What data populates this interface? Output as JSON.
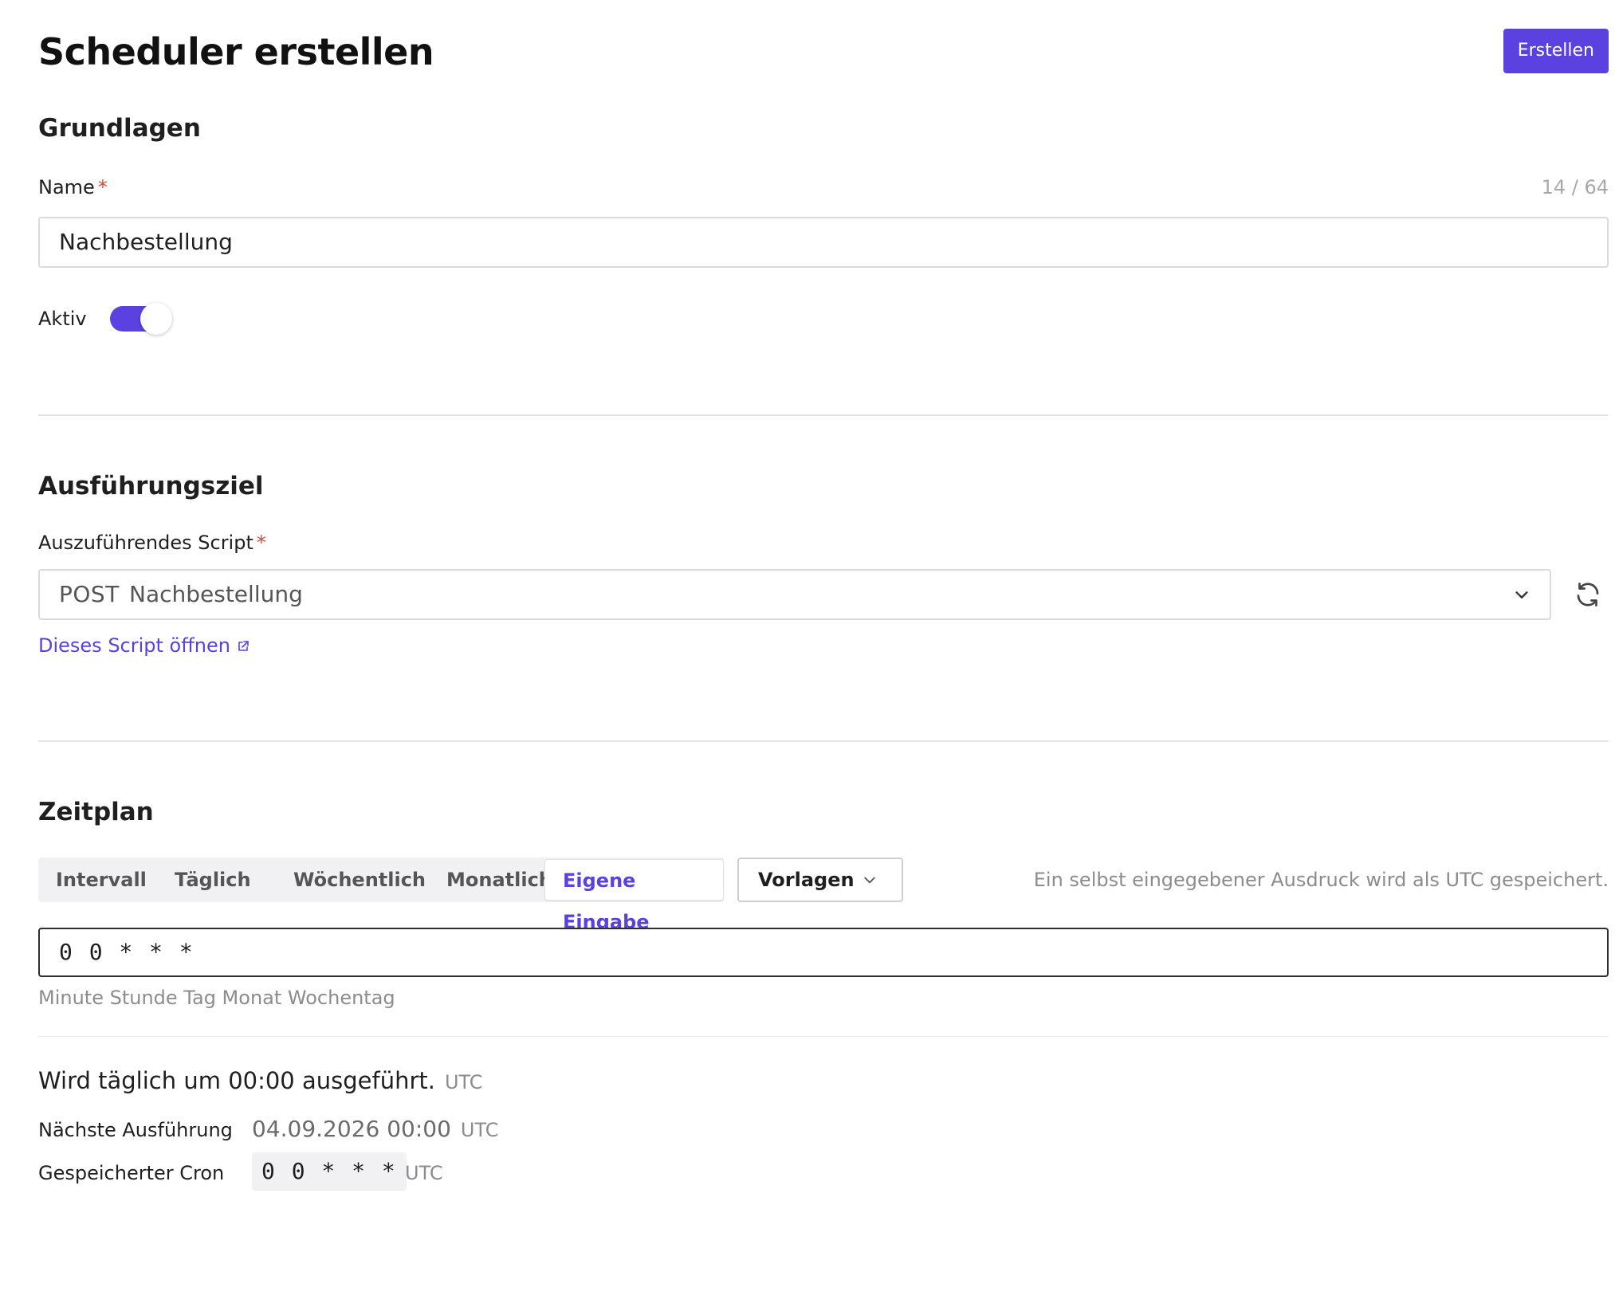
{
  "header": {
    "title": "Scheduler erstellen",
    "create_label": "Erstellen"
  },
  "basics": {
    "title": "Grundlagen",
    "name_label": "Name",
    "required_mark": "*",
    "name_value": "Nachbestellung",
    "name_counter": "14 / 64",
    "active_label": "Aktiv",
    "active": true
  },
  "target": {
    "title": "Ausführungsziel",
    "script_label": "Auszuführendes Script",
    "script_method": "POST",
    "script_name": "Nachbestellung",
    "open_link": "Dieses Script öffnen"
  },
  "schedule": {
    "title": "Zeitplan",
    "tabs": [
      {
        "label": "Intervall",
        "active": false
      },
      {
        "label": "Täglich",
        "active": false
      },
      {
        "label": "Wöchentlich",
        "active": false
      },
      {
        "label": "Monatlich",
        "active": false
      },
      {
        "label": "Eigene Eingabe",
        "active": true
      }
    ],
    "templates_label": "Vorlagen",
    "hint": "Ein selbst eingegebener Ausdruck wird als UTC gespeichert.",
    "cron_value": "0 0 * * *",
    "cron_fields_hint": "Minute Stunde Tag Monat Wochentag",
    "summary": "Wird täglich um 00:00 ausgeführt.",
    "tz": "UTC",
    "next_run_label": "Nächste Ausführung",
    "next_run_value": "04.09.2026 00:00",
    "stored_cron_label": "Gespeicherter Cron",
    "stored_cron_value": "0 0 * * *"
  },
  "colors": {
    "accent": "#5b41e0",
    "required": "#d9453b"
  }
}
